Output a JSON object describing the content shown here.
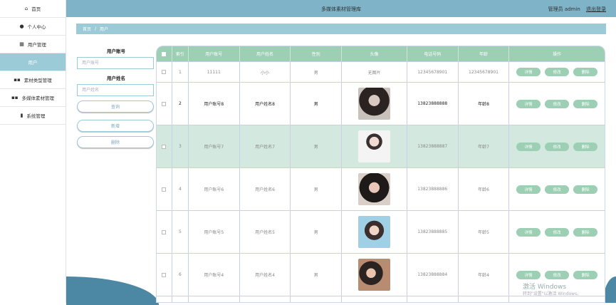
{
  "sidebar": {
    "items": [
      {
        "label": "首页",
        "icon": "home-icon"
      },
      {
        "label": "个人中心",
        "icon": "user-icon"
      },
      {
        "label": "用户管理",
        "icon": "grid-icon"
      },
      {
        "label": "用户",
        "icon": ""
      },
      {
        "label": "素材类型管理",
        "icon": "apps-icon"
      },
      {
        "label": "多媒体素材管理",
        "icon": "apps-icon"
      },
      {
        "label": "系统管理",
        "icon": "bar-chart-icon"
      }
    ]
  },
  "header": {
    "title": "多媒体素材管理库",
    "user": "管理员 admin",
    "logout": "退出登录"
  },
  "breadcrumb": {
    "home": "首页",
    "sep": "/",
    "current": "用户"
  },
  "search": {
    "account_label": "用户账号",
    "account_placeholder": "用户账号",
    "name_label": "用户姓名",
    "name_placeholder": "用户姓名",
    "query": "查询",
    "add": "新增",
    "delete": "删除"
  },
  "table": {
    "headers": [
      "索引",
      "用户账号",
      "用户姓名",
      "性别",
      "头像",
      "电话号码",
      "年龄",
      "操作"
    ],
    "actions": {
      "detail": "详情",
      "edit": "修改",
      "delete": "删除"
    },
    "rows": [
      {
        "index": "1",
        "account": "11111",
        "name": "小小",
        "gender": "男",
        "avatar": "无图片",
        "phone": "12345678901",
        "age": "12345678901"
      },
      {
        "index": "2",
        "account": "用户账号8",
        "name": "用户姓名8",
        "gender": "男",
        "avatar": "",
        "phone": "13823888888",
        "age": "年龄8"
      },
      {
        "index": "3",
        "account": "用户账号7",
        "name": "用户姓名7",
        "gender": "男",
        "avatar": "",
        "phone": "13823888887",
        "age": "年龄7"
      },
      {
        "index": "4",
        "account": "用户账号6",
        "name": "用户姓名6",
        "gender": "男",
        "avatar": "",
        "phone": "13823888886",
        "age": "年龄6"
      },
      {
        "index": "5",
        "account": "用户账号5",
        "name": "用户姓名5",
        "gender": "男",
        "avatar": "",
        "phone": "13823888885",
        "age": "年龄5"
      },
      {
        "index": "6",
        "account": "用户账号4",
        "name": "用户姓名4",
        "gender": "男",
        "avatar": "",
        "phone": "13823888884",
        "age": "年龄4"
      }
    ]
  },
  "watermark": {
    "line1": "激活 Windows",
    "line2": "转到\"设置\"以激活 Windows。"
  },
  "colors": {
    "accent": "#9ccbd8",
    "header": "#7fb3c7",
    "table_header": "#9ccfb4",
    "highlight_row": "#d3e9df"
  }
}
